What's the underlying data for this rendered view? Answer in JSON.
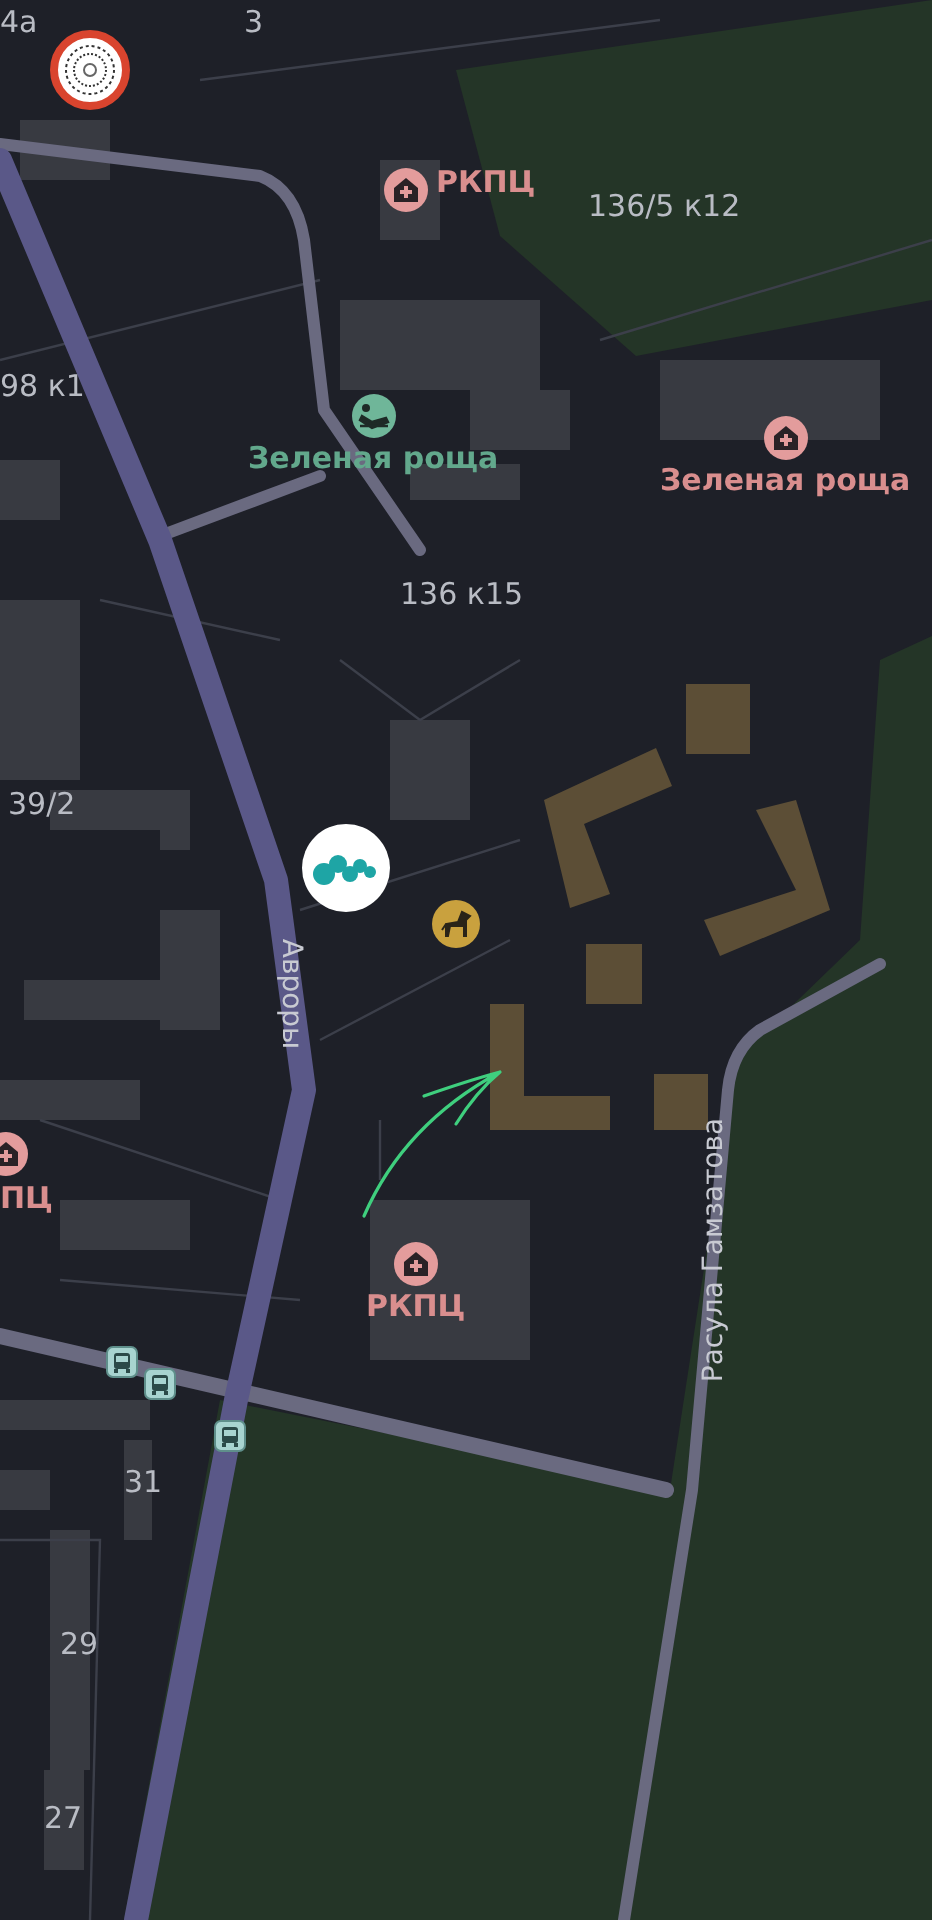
{
  "map": {
    "house_numbers": [
      {
        "text": "4a"
      },
      {
        "text": "3"
      },
      {
        "text": "136/5 к12"
      },
      {
        "text": "98 к1"
      },
      {
        "text": "136 к15"
      },
      {
        "text": "39/2"
      },
      {
        "text": "31"
      },
      {
        "text": "29"
      },
      {
        "text": "27"
      }
    ],
    "streets": [
      {
        "name": "Авроры"
      },
      {
        "name": "Расула Гамзатова"
      }
    ],
    "places": [
      {
        "kind": "clinic",
        "label": "РКПЦ"
      },
      {
        "kind": "sanatorium",
        "label": "Зеленая роща"
      },
      {
        "kind": "clinic",
        "label": "Зеленая роща"
      },
      {
        "kind": "clinic",
        "label": "ПЦ"
      },
      {
        "kind": "clinic",
        "label": "РКПЦ"
      }
    ],
    "markers": [
      {
        "kind": "ring"
      },
      {
        "kind": "company"
      },
      {
        "kind": "horse"
      },
      {
        "kind": "bus"
      },
      {
        "kind": "bus"
      },
      {
        "kind": "bus"
      }
    ]
  }
}
